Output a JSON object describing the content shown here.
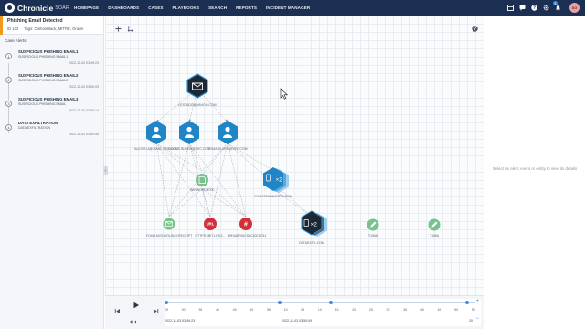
{
  "header": {
    "logo_text": "Chronicle",
    "logo_sub": "SOAR",
    "nav": [
      "HOMEPAGE",
      "DASHBOARDS",
      "CASES",
      "PLAYBOOKS",
      "SEARCH",
      "REPORTS",
      "INCIDENT MANAGER"
    ],
    "notification_count": "1",
    "avatar_initials": "SG"
  },
  "case": {
    "title": "Phishing Email Detected",
    "id": "ID 102",
    "tags": "Tags: CarbonBlack, MITRE, Oracle"
  },
  "alerts_label": "Case Alerts",
  "alerts": [
    {
      "num": "1",
      "title": "SUSPICIOUS PHISHING EMAIL1",
      "sub": "SUSPICIOUS PHISHING EMAIL1",
      "time": "2022-11-03 03:49:23"
    },
    {
      "num": "2",
      "title": "SUSPICIOUS PHISHING EMAIL2",
      "sub": "SUSPICIOUS PHISHING EMAIL2",
      "time": "2022-11-03 03:50:03"
    },
    {
      "num": "3",
      "title": "SUSPICIOUS PHISHING EMAIL3",
      "sub": "SUSPICIOUS PHISHING EMAIL",
      "time": "2022-11-03 03:50:14"
    },
    {
      "num": "4",
      "title": "DATA EXFILTRATION",
      "sub": "DATA EXFILTRATION",
      "time": "2022-11-03 03:50:59"
    }
  ],
  "graph": {
    "nodes": [
      {
        "label": "LESTADO@VAHOO.COM"
      },
      {
        "label": "ALEXIS.U@GMAIL-SEC.COM"
      },
      {
        "label": "MGOCE.BLUEM@VEC.COM"
      },
      {
        "label": "TOMA.BLUEM@VEC.COM"
      },
      {
        "label": "WINWORD.EXE"
      },
      {
        "label": "PHANTOM-ALERTS.COM"
      },
      {
        "label": "×2"
      },
      {
        "label": "YOUR.MVS.HOLIDAY.RECEIPT"
      },
      {
        "label": "HTTPS://BIT.LY/DZ..."
      },
      {
        "label": "89E4A8F06CS6C30C5C51"
      },
      {
        "label": "DATAEXFIL.COM"
      },
      {
        "label": "×2"
      },
      {
        "label": "T1566"
      },
      {
        "label": "T1566"
      }
    ]
  },
  "right_panel": {
    "empty_text": "Select an alert, event or entity to view its details"
  },
  "timeline": {
    "ticks": [
      "25",
      "30",
      "35",
      "40",
      "45",
      "50",
      "55",
      "10",
      "05",
      "10",
      "15",
      "20",
      "25",
      "30",
      "35",
      "40",
      "45",
      "50",
      "55"
    ],
    "date_start": "2022-11-03 03:49:23",
    "date_mid": "2022-11-03 03:50:09",
    "end_label": "20"
  }
}
